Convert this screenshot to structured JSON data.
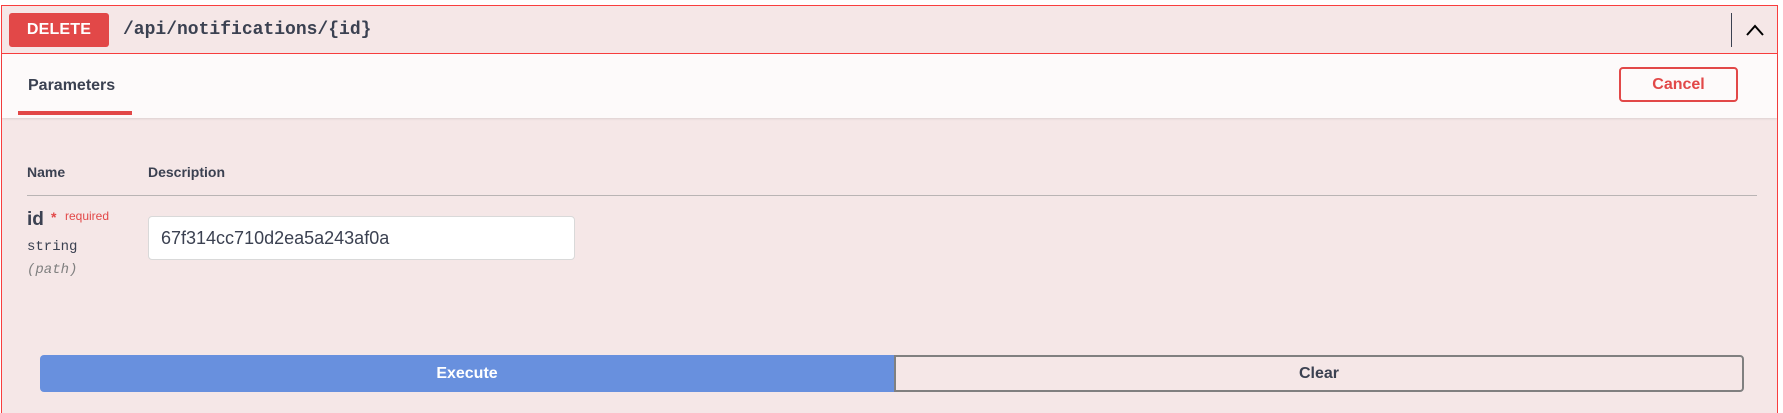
{
  "operation": {
    "method": "DELETE",
    "path": "/api/notifications/{id}",
    "collapse_icon": "chevron-up-icon"
  },
  "tabs": {
    "parameters_label": "Parameters",
    "cancel_label": "Cancel"
  },
  "table": {
    "headers": {
      "name": "Name",
      "description": "Description"
    },
    "parameter": {
      "name": "id",
      "required_mark": "*",
      "required_label": "required",
      "type": "string",
      "location": "(path)",
      "value": "67f314cc710d2ea5a243af0a"
    }
  },
  "actions": {
    "execute_label": "Execute",
    "clear_label": "Clear"
  },
  "colors": {
    "delete": "#e24848",
    "execute": "#6890de",
    "background": "#f5e7e7"
  }
}
